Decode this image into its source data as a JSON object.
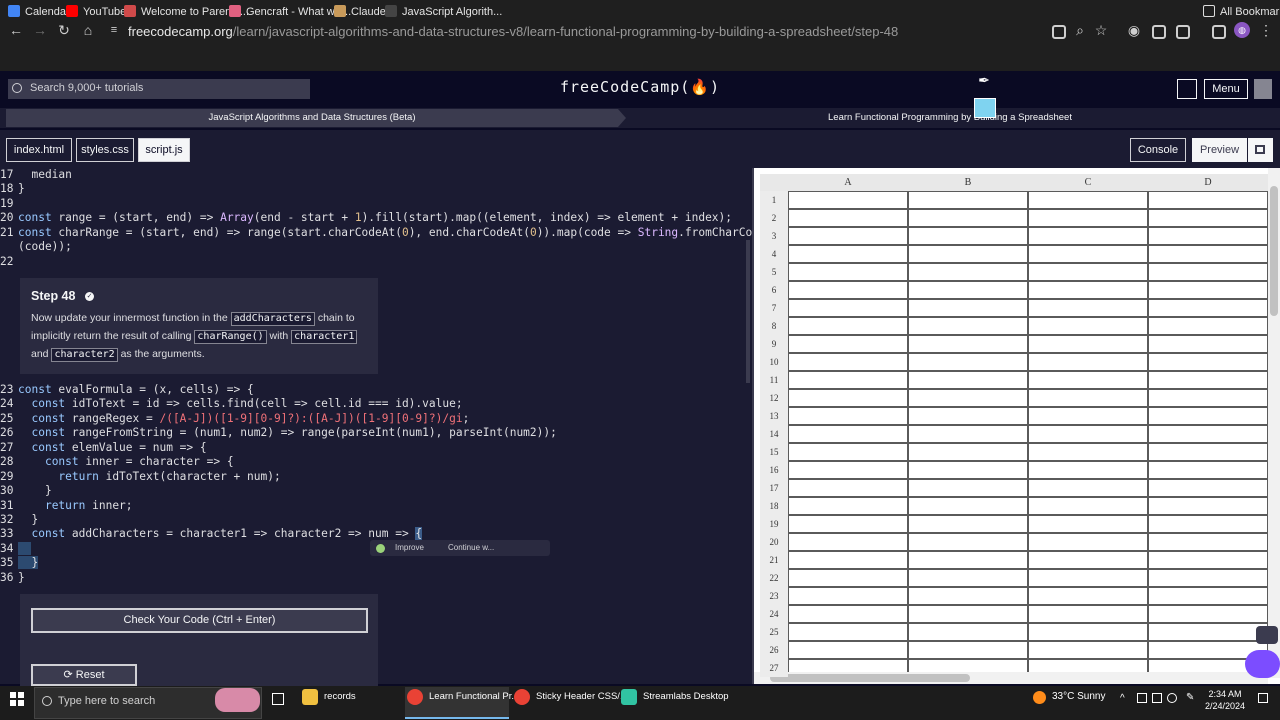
{
  "browser": {
    "url_host": "freecodecamp.org",
    "url_path": "/learn/javascript-algorithms-and-data-structures-v8/learn-functional-programming-by-building-a-spreadsheet/step-48",
    "bookmarks": [
      "Calendar",
      "YouTube",
      "Welcome to Parents...",
      "Gencraft - What will...",
      "Claude",
      "JavaScript Algorith..."
    ],
    "all_bookmarks": "All Bookmarks"
  },
  "nav": {
    "search_placeholder": "Search 9,000+ tutorials",
    "logo": "freeCodeCamp(🔥)",
    "menu": "Menu"
  },
  "breadcrumb": {
    "course": "JavaScript Algorithms and Data Structures (Beta)",
    "project": "Learn Functional Programming by Building a Spreadsheet"
  },
  "tabs": {
    "files": [
      "index.html",
      "styles.css",
      "script.js"
    ],
    "active": "script.js",
    "console": "Console",
    "preview": "Preview"
  },
  "step": {
    "title": "Step 48",
    "line1_a": "Now update your innermost function in the ",
    "line1_code": "addCharacters",
    "line1_b": " chain to",
    "line2_a": "implicitly return the result of calling ",
    "line2_code1": "charRange()",
    "line2_mid": " with ",
    "line2_code2": "character1",
    "line3_a": "and ",
    "line3_code": "character2",
    "line3_b": " as the arguments."
  },
  "ai_popup": {
    "improve": "Improve",
    "continue": "Continue w..."
  },
  "actions": {
    "check": "Check Your Code (Ctrl + Enter)",
    "reset": "Reset"
  },
  "spreadsheet": {
    "columns": [
      "A",
      "B",
      "C",
      "D"
    ],
    "rows": [
      "1",
      "2",
      "3",
      "4",
      "5",
      "6",
      "7",
      "8",
      "9",
      "10",
      "11",
      "12",
      "13",
      "14",
      "15",
      "16",
      "17",
      "18",
      "19",
      "20",
      "21",
      "22",
      "23",
      "24",
      "25",
      "26",
      "27"
    ]
  },
  "taskbar": {
    "search": "Type here to search",
    "apps": [
      "records",
      "Learn Functional Pr...",
      "Sticky Header CSS/...",
      "Streamlabs Desktop"
    ],
    "weather_temp": "33°C",
    "weather_desc": "Sunny",
    "time": "2:34 AM",
    "date": "2/24/2024"
  }
}
